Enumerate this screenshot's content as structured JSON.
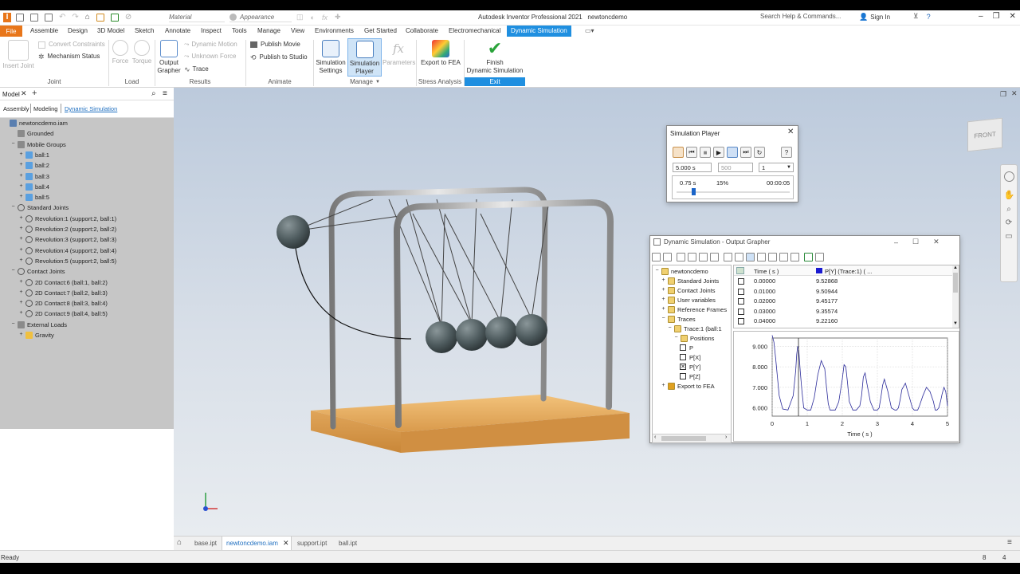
{
  "titlebar": {
    "material_placeholder": "Material",
    "appearance_placeholder": "Appearance",
    "app_title": "Autodesk Inventor Professional 2021",
    "doc_title": "newtoncdemo",
    "search_placeholder": "Search Help & Commands...",
    "sign_in": "Sign In"
  },
  "tabs": [
    "File",
    "Assemble",
    "Design",
    "3D Model",
    "Sketch",
    "Annotate",
    "Inspect",
    "Tools",
    "Manage",
    "View",
    "Environments",
    "Get Started",
    "Collaborate",
    "Electromechanical",
    "Dynamic Simulation"
  ],
  "ribbon": {
    "insert_joint": "Insert Joint",
    "convert_constraints": "Convert Constraints",
    "mechanism_status": "Mechanism Status",
    "force": "Force",
    "torque": "Torque",
    "dynamic_motion": "Dynamic Motion",
    "unknown_force": "Unknown Force",
    "output_grapher": "Output\nGrapher",
    "output_grapher_l1": "Output",
    "output_grapher_l2": "Grapher",
    "trace": "Trace",
    "publish_movie": "Publish Movie",
    "publish_studio": "Publish to Studio",
    "sim_settings_l1": "Simulation",
    "sim_settings_l2": "Settings",
    "sim_player_l1": "Simulation",
    "sim_player_l2": "Player",
    "parameters": "Parameters",
    "export_fea": "Export to FEA",
    "finish_l1": "Finish",
    "finish_l2": "Dynamic Simulation",
    "groups": {
      "joint": "Joint",
      "load": "Load",
      "results": "Results",
      "animate": "Animate",
      "manage": "Manage",
      "stress": "Stress Analysis",
      "exit": "Exit"
    }
  },
  "browser": {
    "title": "Model",
    "tabs": [
      "Assembly",
      "Modeling",
      "Dynamic Simulation"
    ],
    "tree": [
      {
        "label": "newtoncdemo.iam",
        "indent": 0
      },
      {
        "label": "Grounded",
        "indent": 1
      },
      {
        "label": "Mobile Groups",
        "indent": 1
      },
      {
        "label": "ball:1",
        "indent": 2
      },
      {
        "label": "ball:2",
        "indent": 2
      },
      {
        "label": "ball:3",
        "indent": 2
      },
      {
        "label": "ball:4",
        "indent": 2
      },
      {
        "label": "ball:5",
        "indent": 2
      },
      {
        "label": "Standard Joints",
        "indent": 1
      },
      {
        "label": "Revolution:1 (support:2, ball:1)",
        "indent": 2
      },
      {
        "label": "Revolution:2 (support:2, ball:2)",
        "indent": 2
      },
      {
        "label": "Revolution:3 (support:2, ball:3)",
        "indent": 2
      },
      {
        "label": "Revolution:4 (support:2, ball:4)",
        "indent": 2
      },
      {
        "label": "Revolution:5 (support:2, ball:5)",
        "indent": 2
      },
      {
        "label": "Contact Joints",
        "indent": 1
      },
      {
        "label": "2D Contact:6 (ball:1, ball:2)",
        "indent": 2
      },
      {
        "label": "2D Contact:7 (ball:2, ball:3)",
        "indent": 2
      },
      {
        "label": "2D Contact:8 (ball:3, ball:4)",
        "indent": 2
      },
      {
        "label": "2D Contact:9 (ball:4, ball:5)",
        "indent": 2
      },
      {
        "label": "External Loads",
        "indent": 1
      },
      {
        "label": "Gravity",
        "indent": 2
      }
    ]
  },
  "sim_player": {
    "title": "Simulation Player",
    "end_time": "5.000 s",
    "images": "500",
    "filter": "1",
    "current_time": "0.75 s",
    "percent": "15%",
    "elapsed": "00:00:05",
    "progress_fraction": 0.15
  },
  "grapher": {
    "title": "Dynamic Simulation - Output Grapher",
    "tree": [
      {
        "label": "newtoncdemo",
        "indent": 0
      },
      {
        "label": "Standard Joints",
        "indent": 1
      },
      {
        "label": "Contact Joints",
        "indent": 1
      },
      {
        "label": "User variables",
        "indent": 1
      },
      {
        "label": "Reference Frames",
        "indent": 1
      },
      {
        "label": "Traces",
        "indent": 1
      },
      {
        "label": "Trace:1 (ball:1",
        "indent": 2
      },
      {
        "label": "Positions",
        "indent": 3
      },
      {
        "label": "P",
        "indent": 4
      },
      {
        "label": "P[X]",
        "indent": 4
      },
      {
        "label": "P[Y]",
        "indent": 4
      },
      {
        "label": "P[Z]",
        "indent": 4
      },
      {
        "label": "Export to FEA",
        "indent": 1
      }
    ],
    "col_time": "Time ( s )",
    "col_value": "P[Y] (Trace:1) ( ...",
    "rows": [
      [
        "0.00000",
        "9.52868"
      ],
      [
        "0.01000",
        "9.50944"
      ],
      [
        "0.02000",
        "9.45177"
      ],
      [
        "0.03000",
        "9.35574"
      ],
      [
        "0.04000",
        "9.22160"
      ]
    ]
  },
  "chart_data": {
    "type": "line",
    "title": "",
    "xlabel": "Time ( s )",
    "ylabel": "",
    "xlim": [
      0,
      5
    ],
    "ylim": [
      5.6,
      9.4
    ],
    "xticks": [
      "0",
      "1",
      "2",
      "3",
      "4",
      "5"
    ],
    "yticks": [
      "6.000",
      "7.000",
      "8.000",
      "9.000"
    ],
    "cursor_x": 0.75,
    "series": [
      {
        "color": "#2b2b9a",
        "x": [
          0,
          0.05,
          0.1,
          0.2,
          0.3,
          0.45,
          0.6,
          0.67,
          0.7,
          0.73,
          0.76,
          0.8,
          0.85,
          0.9,
          1.0,
          1.1,
          1.2,
          1.3,
          1.4,
          1.5,
          1.55,
          1.6,
          1.65,
          1.7,
          1.8,
          1.9,
          2.0,
          2.05,
          2.1,
          2.15,
          2.2,
          2.3,
          2.4,
          2.5,
          2.55,
          2.6,
          2.65,
          2.7,
          2.8,
          2.9,
          3.0,
          3.05,
          3.1,
          3.15,
          3.2,
          3.3,
          3.4,
          3.5,
          3.55,
          3.6,
          3.65,
          3.7,
          3.8,
          3.9,
          4.0,
          4.05,
          4.1,
          4.15,
          4.2,
          4.3,
          4.4,
          4.5,
          4.6,
          4.65,
          4.7,
          4.75,
          4.8,
          4.85,
          4.9,
          4.95,
          5.0
        ],
        "y": [
          9.53,
          9.2,
          8.4,
          6.6,
          5.95,
          5.9,
          6.6,
          7.8,
          8.6,
          9.0,
          8.8,
          7.8,
          6.8,
          6.0,
          5.9,
          5.9,
          6.5,
          7.6,
          8.3,
          7.9,
          7.0,
          6.2,
          5.9,
          5.9,
          5.9,
          6.3,
          7.4,
          8.1,
          8.0,
          7.2,
          6.3,
          5.9,
          5.9,
          6.1,
          6.6,
          7.5,
          7.7,
          7.2,
          6.3,
          5.9,
          5.9,
          6.0,
          6.5,
          7.1,
          7.4,
          6.8,
          6.0,
          5.9,
          5.9,
          6.0,
          6.4,
          6.9,
          7.2,
          6.6,
          6.0,
          5.9,
          5.9,
          5.9,
          6.1,
          6.6,
          7.0,
          6.8,
          6.3,
          5.9,
          5.9,
          6.0,
          6.3,
          6.7,
          7.0,
          6.8,
          6.1
        ]
      }
    ]
  },
  "doc_tabs": [
    "base.ipt",
    "newtoncdemo.iam",
    "support.ipt",
    "ball.ipt"
  ],
  "status": {
    "text": "Ready",
    "num1": "8",
    "num2": "4"
  },
  "viewcube_label": "FRONT"
}
